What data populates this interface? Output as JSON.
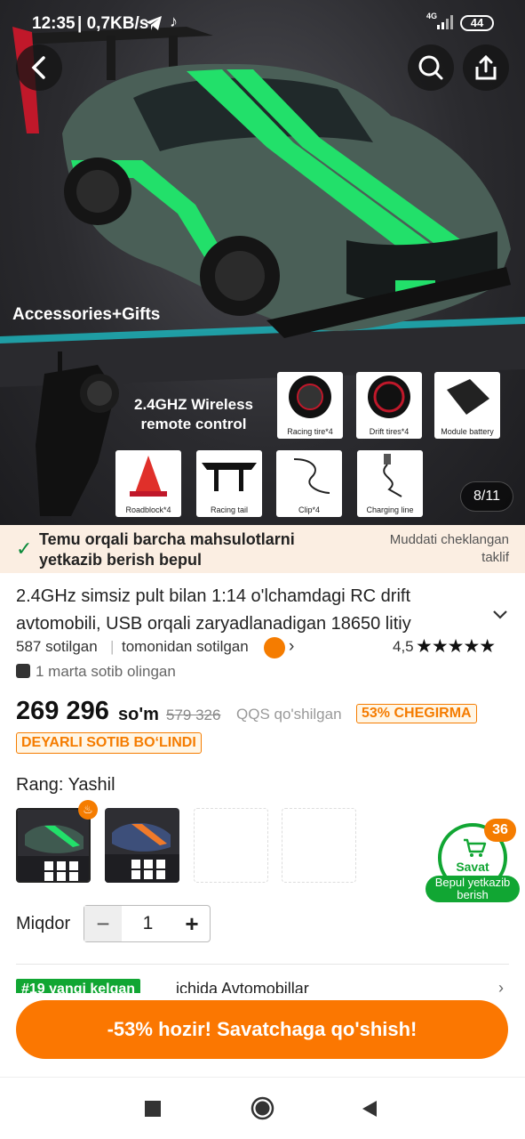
{
  "statusbar": {
    "time": "12:35",
    "speed": "| 0,7KB/s",
    "network": "4G",
    "battery": "44"
  },
  "hero": {
    "accessories_text": "Accessories+Gifts",
    "remote_text": "2.4GHZ Wireless remote control",
    "tiles": [
      "Racing tire*4",
      "Drift tires*4",
      "Module battery",
      "Roadblock*4",
      "Racing tail",
      "Clip*4",
      "Charging line"
    ],
    "counter": "8/11",
    "brand_colors": {
      "car_green": "#22e06a",
      "body": "#4a5f57"
    }
  },
  "shipping_banner": {
    "message": "Temu orqali barcha mahsulotlarni yetkazib berish bepul",
    "limited": "Muddati cheklangan taklif"
  },
  "product": {
    "title": "2.4GHz simsiz pult bilan 1:14 o'lchamdagi RC drift avtomobili, USB orqali zaryadlanadigan 18650 litiy",
    "sold": "587 sotilgan",
    "seller": "tomonidan sotilgan",
    "rating": "4,5",
    "stars": "★★★★★",
    "purchased": "1 marta sotib olingan",
    "price": "269 296",
    "currency": "so'm",
    "old_price": "579 326",
    "vat": "QQS qo'shilgan",
    "discount": "53% CHEGIRMA",
    "almost_sold": "DEYARLI SOTIB BO‘LINDI"
  },
  "variants": {
    "label": "Rang: Yashil"
  },
  "cart": {
    "count": "36",
    "label": "Savat",
    "shipping": "Bepul yetkazib berish"
  },
  "quantity": {
    "label": "Miqdor",
    "value": "1",
    "minus": "−",
    "plus": "+"
  },
  "rank": {
    "badge": "#19 yangi kelgan",
    "text": "ichida Avtomobillar"
  },
  "cta": {
    "label": "-53% hozir! Savatchaga qo'shish!"
  },
  "accent": "#fb7701"
}
